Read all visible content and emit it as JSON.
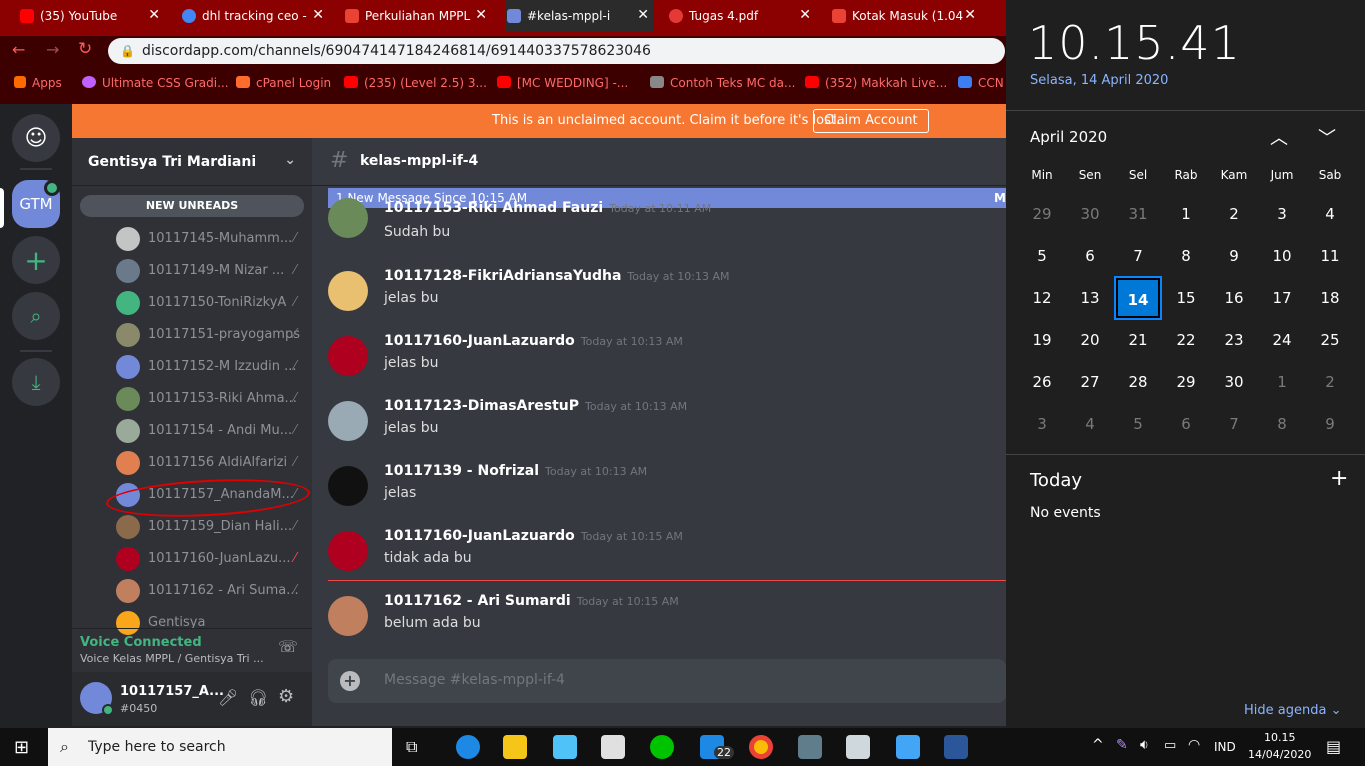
{
  "browser": {
    "tabs": [
      {
        "label": "(35) YouTube",
        "color": "#ff0000"
      },
      {
        "label": "dhl tracking ceo -",
        "color": "#4285f4"
      },
      {
        "label": "Perkuliahan MPPL",
        "color": "#ea4335"
      },
      {
        "label": "#kelas-mppl-i",
        "color": "#7289da"
      },
      {
        "label": "Tugas 4.pdf",
        "color": "#e53935"
      },
      {
        "label": "Kotak Masuk (1.04",
        "color": "#ea4335"
      }
    ],
    "url": "discordapp.com/channels/690474147184246814/691440337578623046",
    "bookmarks": [
      "Apps",
      "Ultimate CSS Gradi...",
      "cPanel Login",
      "(235) (Level 2.5) 3...",
      "[MC WEDDING] -...",
      "Contoh Teks MC da...",
      "(352) Makkah Live...",
      "CCN"
    ]
  },
  "discord": {
    "guild_label": "GTM",
    "banner_text": "This is an unclaimed account. Claim it before it's lost.",
    "claim_label": "Claim Account",
    "server_name": "Gentisya Tri Mardiani",
    "new_unreads": "NEW UNREADS",
    "members": [
      {
        "name": "10117145-Muhamm...",
        "color": "#c4c4c4"
      },
      {
        "name": "10117149-M Nizar ...",
        "color": "#6b7a8a"
      },
      {
        "name": "10117150-ToniRizkyA",
        "color": "#43b581"
      },
      {
        "name": "10117151-prayogamps",
        "color": "#8a8a6a"
      },
      {
        "name": "10117152-M Izzudin ...",
        "color": "#7289da"
      },
      {
        "name": "10117153-Riki Ahma...",
        "color": "#6a8a5a"
      },
      {
        "name": "10117154 - Andi Mu...",
        "color": "#9aaa9a"
      },
      {
        "name": "10117156 AldiAlfarizi",
        "color": "#e08050"
      },
      {
        "name": "10117157_AnandaM...",
        "color": "#7289da"
      },
      {
        "name": "10117159_Dian Hali...",
        "color": "#8a6a4a"
      },
      {
        "name": "10117160-JuanLazu...",
        "color": "#b00020"
      },
      {
        "name": "10117162 - Ari Suma...",
        "color": "#c08060"
      },
      {
        "name": "Gentisya",
        "color": "#faa61a"
      }
    ],
    "voice_status": "Voice Connected",
    "voice_channel": "Voice Kelas MPPL / Gentisya Tri ...",
    "user_name": "10117157_A...",
    "user_tag": "#0450",
    "channel_name": "kelas-mppl-if-4",
    "new_message_bar": "1 New Message Since 10:15 AM",
    "new_message_right": "M",
    "messages": [
      {
        "author": "10117153-Riki Ahmad Fauzi",
        "time": "Today at 10:11 AM",
        "text": "Sudah bu",
        "color": "#6a8a5a"
      },
      {
        "author": "10117128-FikriAdriansaYudha",
        "time": "Today at 10:13 AM",
        "text": "jelas bu",
        "color": "#e8c070"
      },
      {
        "author": "10117160-JuanLazuardo",
        "time": "Today at 10:13 AM",
        "text": "jelas bu",
        "color": "#b00020"
      },
      {
        "author": "10117123-DimasArestuP",
        "time": "Today at 10:13 AM",
        "text": "jelas bu",
        "color": "#99aab5"
      },
      {
        "author": "10117139 - Nofrizal",
        "time": "Today at 10:13 AM",
        "text": "jelas",
        "color": "#111111"
      },
      {
        "author": "10117160-JuanLazuardo",
        "time": "Today at 10:15 AM",
        "text": "tidak ada bu",
        "color": "#b00020"
      },
      {
        "author": "10117162 - Ari Sumardi",
        "time": "Today at 10:15 AM",
        "text": "belum ada bu",
        "color": "#c08060"
      }
    ],
    "composer_placeholder": "Message #kelas-mppl-if-4"
  },
  "calendar": {
    "clock": "10.15.41",
    "date_long": "Selasa, 14 April 2020",
    "month_label": "April 2020",
    "weekdays": [
      "Min",
      "Sen",
      "Sel",
      "Rab",
      "Kam",
      "Jum",
      "Sab"
    ],
    "days": [
      [
        "29",
        "30",
        "31",
        "1",
        "2",
        "3",
        "4"
      ],
      [
        "5",
        "6",
        "7",
        "8",
        "9",
        "10",
        "11"
      ],
      [
        "12",
        "13",
        "14",
        "15",
        "16",
        "17",
        "18"
      ],
      [
        "19",
        "20",
        "21",
        "22",
        "23",
        "24",
        "25"
      ],
      [
        "26",
        "27",
        "28",
        "29",
        "30",
        "1",
        "2"
      ],
      [
        "3",
        "4",
        "5",
        "6",
        "7",
        "8",
        "9"
      ]
    ],
    "today_label": "Today",
    "no_events": "No events",
    "hide_agenda": "Hide agenda"
  },
  "taskbar": {
    "search_placeholder": "Type here to search",
    "language": "IND",
    "time": "10.15",
    "date": "14/04/2020",
    "mail_badge": "22"
  }
}
